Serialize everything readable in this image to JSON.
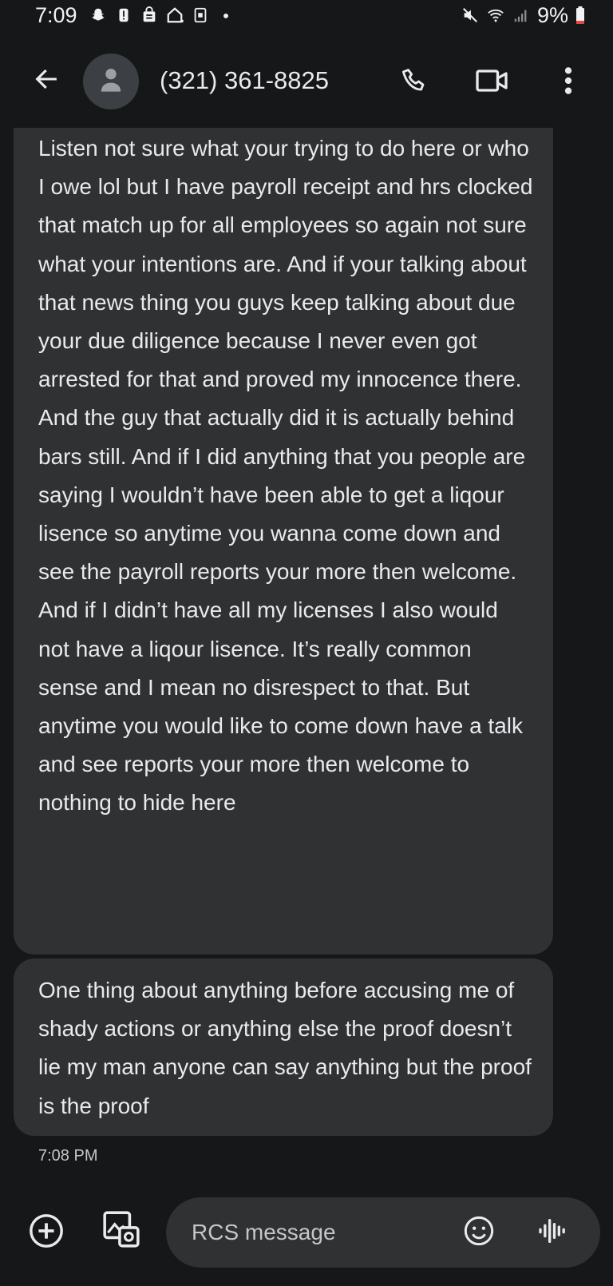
{
  "status_bar": {
    "time": "7:09",
    "battery_percent": "9%",
    "icons": [
      "snapchat-icon",
      "alert-badge-icon",
      "bag-icon",
      "home-alert-icon",
      "sim-icon",
      "dot-icon",
      "mute-icon",
      "wifi-icon",
      "signal-icon",
      "battery-icon"
    ]
  },
  "header": {
    "back_icon": "back-arrow-icon",
    "avatar_icon": "person-icon",
    "contact_name": "(321) 361-8825",
    "call_icon": "phone-icon",
    "video_icon": "video-camera-icon",
    "more_icon": "more-vert-icon"
  },
  "messages": [
    {
      "text": "Listen not sure what your trying to do here or who I owe lol but I have payroll receipt and hrs clocked that match up for all employees so again not sure what your intentions are. And if your talking about that news thing you guys keep talking about due your due diligence because I never even got arrested for that and proved my innocence there. And the guy that actually did it is actually behind bars still. And if I did anything that you people are saying I wouldn’t have been able to get a liqour lisence so anytime you wanna come down and see the payroll reports your more then welcome. And if I didn’t have all my licenses I also would not have a liqour lisence. It’s really common sense and I mean no disrespect to that. But anytime you would like to come down have a talk and see reports your more then welcome to nothing to hide here"
    },
    {
      "text": "One thing about anything before accusing me of shady actions or anything else the proof doesn’t lie my man anyone can say anything but the proof is the proof"
    }
  ],
  "timestamp": "7:08 PM",
  "compose": {
    "placeholder": "RCS message",
    "add_icon": "add-circle-icon",
    "gallery_icon": "gallery-icon",
    "emoji_icon": "emoji-icon",
    "voice_icon": "voice-waveform-icon"
  },
  "colors": {
    "background": "#161718",
    "bubble": "#2f3133",
    "text": "#e8eaed",
    "battery_low": "#e8453c"
  }
}
